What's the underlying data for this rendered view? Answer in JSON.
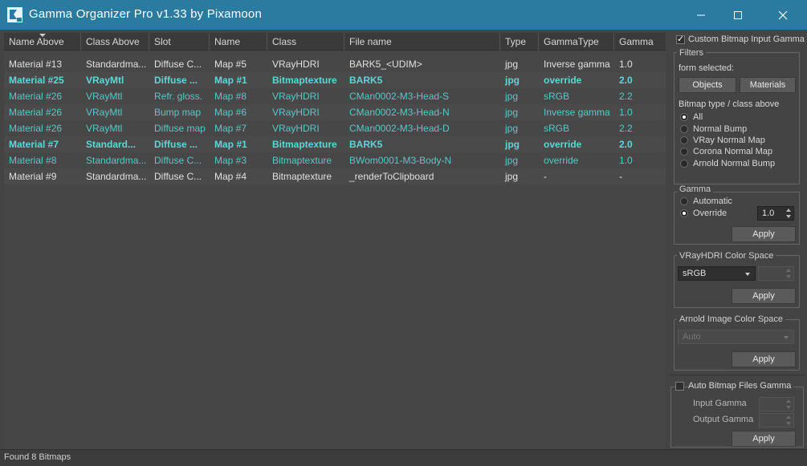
{
  "window": {
    "title": "Gamma Organizer Pro  v1.33  by Pixamoon"
  },
  "table": {
    "columns": [
      "Name Above",
      "Class Above",
      "Slot",
      "Name",
      "Class",
      "File name",
      "Type",
      "GammaType",
      "Gamma"
    ],
    "rows": [
      {
        "style": "dark",
        "cells": [
          "Material #13",
          "Standardma...",
          "Diffuse C...",
          "Map #5",
          "VRayHDRI",
          "BARK5_<UDIM>",
          "jpg",
          "Inverse gamma",
          "1.0"
        ]
      },
      {
        "style": "bold",
        "cells": [
          "Material #25",
          "VRayMtl",
          "Diffuse ...",
          "Map #1",
          "Bitmaptexture",
          "BARK5",
          "jpg",
          "override",
          "2.0"
        ]
      },
      {
        "style": "teal",
        "cells": [
          "Material #26",
          "VRayMtl",
          "Refr. gloss.",
          "Map #8",
          "VRayHDRI",
          "CMan0002-M3-Head-S",
          "jpg",
          "sRGB",
          "2.2"
        ]
      },
      {
        "style": "teal",
        "cells": [
          "Material #26",
          "VRayMtl",
          "Bump map",
          "Map #6",
          "VRayHDRI",
          "CMan0002-M3-Head-N",
          "jpg",
          "Inverse gamma",
          "1.0"
        ]
      },
      {
        "style": "teal",
        "cells": [
          "Material #26",
          "VRayMtl",
          "Diffuse map",
          "Map #7",
          "VRayHDRI",
          "CMan0002-M3-Head-D",
          "jpg",
          "sRGB",
          "2.2"
        ]
      },
      {
        "style": "bold",
        "cells": [
          "Material #7",
          "Standard...",
          "Diffuse ...",
          "Map #1",
          "Bitmaptexture",
          "BARK5",
          "jpg",
          "override",
          "2.0"
        ]
      },
      {
        "style": "teal",
        "cells": [
          "Material #8",
          "Standardma...",
          "Diffuse C...",
          "Map #3",
          "Bitmaptexture",
          "BWom0001-M3-Body-N",
          "jpg",
          "override",
          "1.0"
        ]
      },
      {
        "style": "dark",
        "cells": [
          "Material #9",
          "Standardma...",
          "Diffuse C...",
          "Map #4",
          "Bitmaptexture",
          "_renderToClipboard",
          "jpg",
          "-",
          "-"
        ]
      }
    ]
  },
  "status": {
    "text": "Found 8 Bitmaps"
  },
  "panel": {
    "custom_gamma_label": "Custom Bitmap Input Gamma",
    "custom_gamma_checked": true,
    "filters": {
      "title": "Filters",
      "form_selected": "form selected:",
      "objects_btn": "Objects",
      "materials_btn": "Materials",
      "bitmap_type_label": "Bitmap type / class above",
      "options": [
        "All",
        "Normal Bump",
        "VRay Normal Map",
        "Corona Normal Map",
        "Arnold Normal Bump"
      ],
      "selected": "All"
    },
    "gamma": {
      "title": "Gamma",
      "automatic": "Automatic",
      "override": "Override",
      "selected": "Override",
      "value": "1.0",
      "apply": "Apply"
    },
    "vray": {
      "title": "VRayHDRI Color Space",
      "value": "sRGB",
      "apply": "Apply"
    },
    "arnold": {
      "title": "Arnold Image Color Space",
      "value": "Auto",
      "apply": "Apply"
    },
    "auto_bitmap": {
      "label": "Auto Bitmap Files Gamma",
      "checked": false,
      "input_gamma": "Input Gamma",
      "output_gamma": "Output Gamma",
      "apply": "Apply"
    }
  },
  "colors": {
    "titlebar": "#2b7aa0",
    "teal_text": "#5cc6c8",
    "bold_teal_text": "#5fd6d8"
  }
}
